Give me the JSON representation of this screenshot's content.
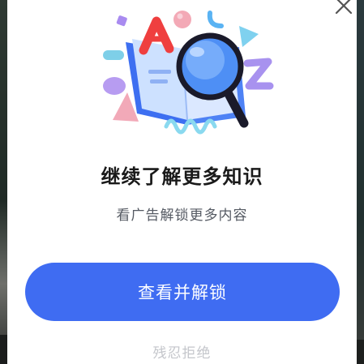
{
  "dialog": {
    "title": "继续了解更多知识",
    "subtitle": "看广告解锁更多内容",
    "primary_button_label": "查看并解锁",
    "secondary_button_label": "残忍拒绝",
    "close_icon": "close-icon",
    "hero_icon": "book-magnifier-illustration"
  },
  "colors": {
    "primary": "#3f6cf2",
    "title": "#1a1a1a",
    "subtitle": "#555a63",
    "secondary_text": "#c4c6cb",
    "background": "#ffffff"
  }
}
